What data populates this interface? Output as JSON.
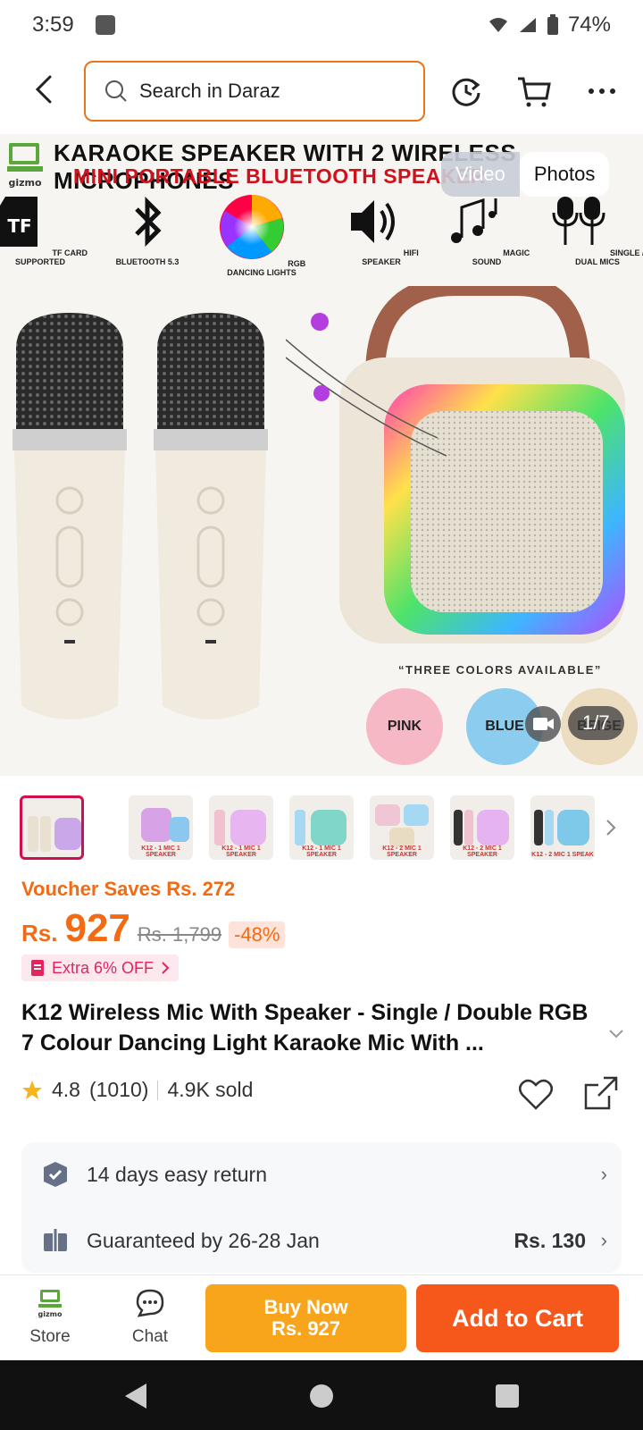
{
  "status": {
    "time": "3:59",
    "battery": "74%"
  },
  "search": {
    "placeholder": "Search in Daraz"
  },
  "gallery": {
    "banner_line1": "KARAOKE SPEAKER WITH 2 WIRELESS MICROPHONES",
    "banner_line2": "MINI PORTABLE BLUETOOTH SPEAKER",
    "brand": "gizmo",
    "features": [
      {
        "label": "TF CARD SUPPORTED",
        "icon": "tf-card-icon"
      },
      {
        "label": "BLUETOOTH 5.3",
        "icon": "bluetooth-icon"
      },
      {
        "label": "RGB DANCING LIGHTS",
        "icon": "rgb-wheel-icon"
      },
      {
        "label": "HIFI SPEAKER",
        "icon": "speaker-icon"
      },
      {
        "label": "MAGIC SOUND",
        "icon": "music-notes-icon"
      },
      {
        "label": "SINGLE / DUAL MICS",
        "icon": "mics-icon"
      }
    ],
    "colors_caption": "“THREE COLORS AVAILABLE”",
    "swatches": [
      {
        "label": "PINK",
        "color": "#f7b8c6"
      },
      {
        "label": "BLUE",
        "color": "#8cccef"
      },
      {
        "label": "BEIGE",
        "color": "#ecdcc0"
      }
    ],
    "toggle_video": "Video",
    "toggle_photos": "Photos",
    "counter": "1/7"
  },
  "thumbnails": [
    {
      "caption": ""
    },
    {
      "caption": "K12 - 1 MIC 1 SPEAKER"
    },
    {
      "caption": "K12 - 1 MIC 1 SPEAKER"
    },
    {
      "caption": "K12 - 1 MIC 1 SPEAKER"
    },
    {
      "caption": "K12 - 2 MIC 1 SPEAKER"
    },
    {
      "caption": "K12 - 2 MIC 1 SPEAKER"
    },
    {
      "caption": "K12 - 2 MIC 1 SPEAK"
    }
  ],
  "pricing": {
    "voucher": "Voucher Saves Rs. 272",
    "currency": "Rs.",
    "price": "927",
    "original": "Rs. 1,799",
    "discount": "-48%",
    "extra": "Extra 6% OFF"
  },
  "product": {
    "title": "K12 Wireless Mic With Speaker - Single / Double RGB 7 Colour Dancing Light Karaoke Mic With ...",
    "rating": "4.8",
    "reviews": "(1010)",
    "sold": "4.9K sold"
  },
  "services": {
    "return_text": "14 days easy return",
    "delivery_text": "Guaranteed by 26-28 Jan",
    "delivery_price": "Rs. 130"
  },
  "bottom": {
    "store": "Store",
    "chat": "Chat",
    "buy_now_line1": "Buy Now",
    "buy_now_line2": "Rs. 927",
    "add_to_cart": "Add to Cart"
  },
  "colors": {
    "accent": "#f26b14",
    "buy": "#f8a51c",
    "cart": "#f6581c"
  }
}
